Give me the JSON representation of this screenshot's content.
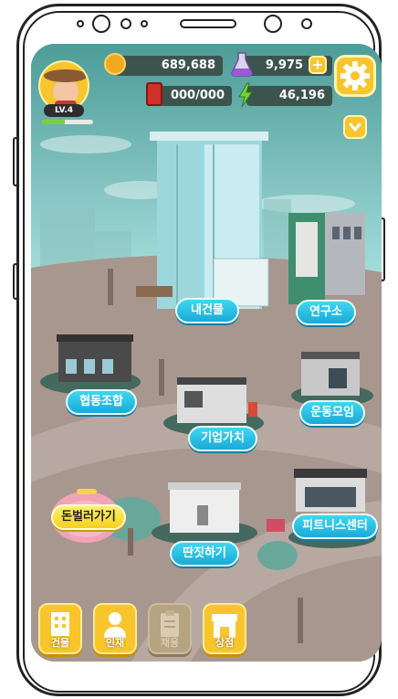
{
  "player": {
    "level": "LV.4",
    "xp_progress": 0.45
  },
  "currencies": {
    "coins": "689,688",
    "potions": "9,975",
    "cards": "000/000",
    "energy": "46,196"
  },
  "buildings": [
    {
      "id": "my-building",
      "label": "내건물"
    },
    {
      "id": "research-lab",
      "label": "연구소"
    },
    {
      "id": "cooperative",
      "label": "협동조합"
    },
    {
      "id": "exercise-club",
      "label": "운동모임"
    },
    {
      "id": "corporate-value",
      "label": "기업가치"
    },
    {
      "id": "earn-money",
      "label": "돈벌러가기"
    },
    {
      "id": "fitness-center",
      "label": "피트니스센터"
    },
    {
      "id": "side-job",
      "label": "딴짓하기"
    }
  ],
  "bottom_nav": [
    {
      "label": "건물",
      "icon": "building-icon",
      "enabled": true
    },
    {
      "label": "인재",
      "icon": "person-icon",
      "enabled": true
    },
    {
      "label": "채용",
      "icon": "clipboard-icon",
      "enabled": false
    },
    {
      "label": "상점",
      "icon": "shop-icon",
      "enabled": true
    }
  ],
  "colors": {
    "hud_bg": "#3c544e",
    "accent_yellow": "#f9c42e",
    "label_blue": "#1ba9d8",
    "ground": "#a5968f"
  }
}
